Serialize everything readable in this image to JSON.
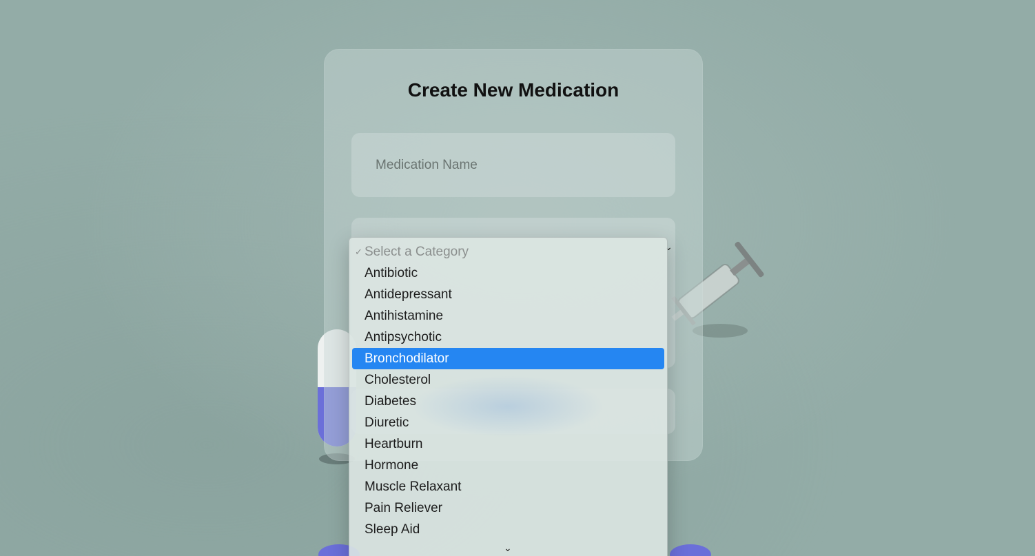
{
  "form": {
    "title": "Create New Medication",
    "name_placeholder": "Medication Name",
    "category_select": {
      "arrow_icon": "chevron-down-icon",
      "options": [
        "Select a Category",
        "Antibiotic",
        "Antidepressant",
        "Antihistamine",
        "Antipsychotic",
        "Bronchodilator",
        "Cholesterol",
        "Diabetes",
        "Diuretic",
        "Heartburn",
        "Hormone",
        "Muscle Relaxant",
        "Pain Reliever",
        "Sleep Aid"
      ],
      "checked_option": "Select a Category",
      "highlighted_option": "Bronchodilator",
      "scroll_icon": "chevron-down-icon"
    }
  },
  "colors": {
    "background": "#93aca7",
    "highlight": "#2586f2",
    "capsule_blue": "#6b6fd9"
  },
  "icons": {
    "check": "checkmark-icon",
    "scroll": "chevron-down-icon"
  }
}
